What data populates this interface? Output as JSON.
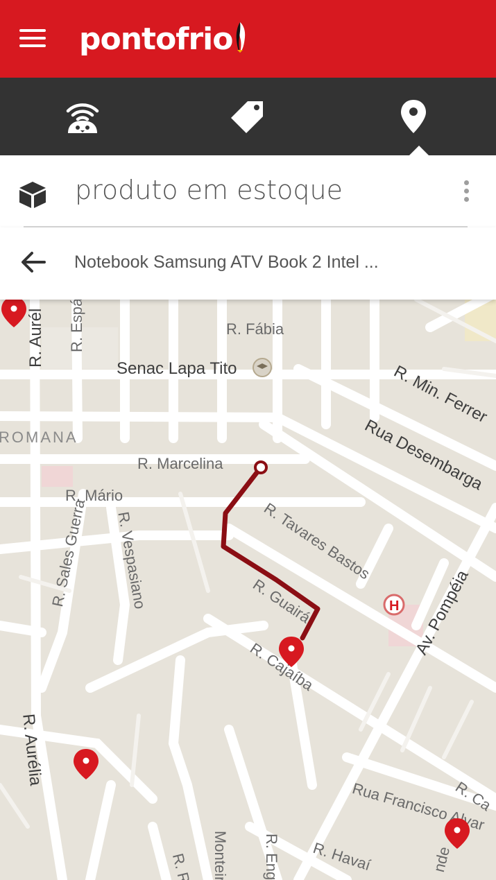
{
  "app": {
    "logo_text": "pontofrio",
    "brand_color": "#d71920"
  },
  "header": {
    "menu_icon": "hamburger-menu-icon"
  },
  "tabs": [
    {
      "icon": "penguin-wifi-icon",
      "selected": false
    },
    {
      "icon": "price-tag-icon",
      "selected": false
    },
    {
      "icon": "location-pin-icon",
      "selected": true
    }
  ],
  "stock": {
    "title": "produto em estoque",
    "icon": "cube-icon"
  },
  "product": {
    "name": "Notebook Samsung ATV Book 2 Intel ..."
  },
  "map": {
    "labels": {
      "fabia": "R. Fábia",
      "senac": "Senac Lapa Tito",
      "min_ferreira": "R. Min. Ferrer",
      "desembargador": "Rua Desembarga",
      "romana": "ROMANA",
      "marcelina": "R. Marcelina",
      "mario": "R. Mário",
      "sales_guerra": "R. Sales Guerra",
      "vespasiano": "R. Vespasiano",
      "tavares_bastos": "R. Tavares Bastos",
      "guaira": "R. Guairá",
      "cajaiba": "R. Cajaíba",
      "pompeia": "Av. Pompéia",
      "aurelia_top": "R. Aurél",
      "espa": "R. Espá",
      "aurelia": "R. Aurélia",
      "francisco": "Rua Francisco Alvar",
      "havai": "R. Havaí",
      "c_right": "R. Ca",
      "monteiro": "Monteiro",
      "eng": "R. Eng",
      "r_bottom": "R. R",
      "nde": "nde"
    },
    "route_color": "#8b0e14",
    "pin_color": "#d71920"
  }
}
